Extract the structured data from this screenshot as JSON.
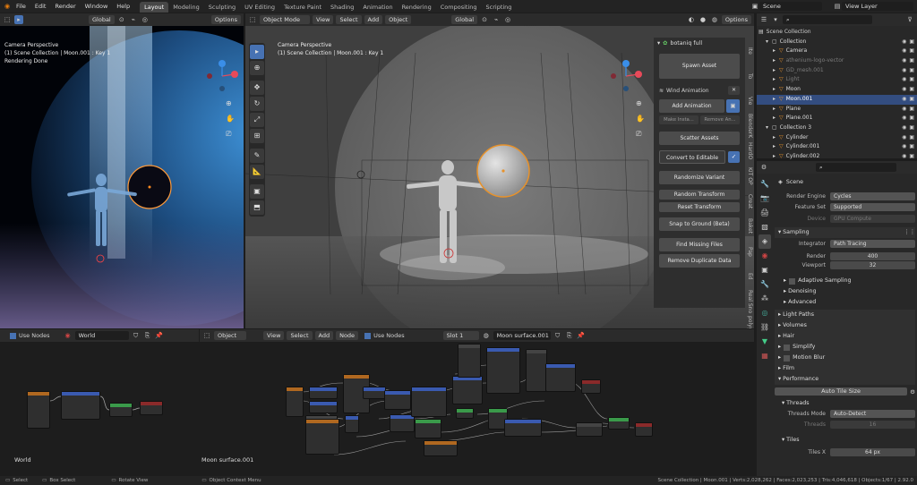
{
  "topbar": {
    "menus": [
      "File",
      "Edit",
      "Render",
      "Window",
      "Help"
    ],
    "workspaces": [
      "Layout",
      "Modeling",
      "Sculpting",
      "UV Editing",
      "Texture Paint",
      "Shading",
      "Animation",
      "Rendering",
      "Compositing",
      "Scripting"
    ],
    "scene": "Scene",
    "view_layer": "View Layer"
  },
  "left_viewport": {
    "orientation": "Global",
    "options": "Options",
    "line1": "Camera Perspective",
    "line2": "(1) Scene Collection | Moon.001 : Key 1",
    "line3": "Rendering Done"
  },
  "main_viewport": {
    "mode": "Object Mode",
    "menus": [
      "View",
      "Select",
      "Add",
      "Object"
    ],
    "orientation": "Global",
    "options": "Options",
    "line1": "Camera Perspective",
    "line2": "(1) Scene Collection | Moon.001 : Key 1"
  },
  "botaniq": {
    "title": "botaniq full",
    "spawn": "Spawn Asset",
    "wind": "Wind Animation",
    "add_anim": "Add Animation",
    "make_inst": "Make Insta...",
    "remove_anim": "Remove An...",
    "scatter": "Scatter Assets",
    "convert": "Convert to Editable",
    "randomize": "Randomize Variant",
    "random_transform": "Random Transform",
    "reset_transform": "Reset Transform",
    "snap": "Snap to Ground (Beta)",
    "find_missing": "Find Missing Files",
    "remove_dup": "Remove Duplicate Data"
  },
  "npanel_tabs": [
    "Ite",
    "To",
    "Vie",
    "BlenderK",
    "HardO",
    "KIT OP",
    "Creat",
    "Baket",
    "Pap",
    "Ed",
    "Real Sno",
    "polygon"
  ],
  "outliner": {
    "root": "Scene Collection",
    "items": [
      {
        "label": "Collection",
        "depth": 1,
        "color": "#dcdcdc"
      },
      {
        "label": "Camera",
        "depth": 2,
        "color": "#dcdcdc"
      },
      {
        "label": "athenium-logo-vector",
        "depth": 2,
        "color": "#7a7a7a"
      },
      {
        "label": "GD_mesh.001",
        "depth": 2,
        "color": "#7a7a7a"
      },
      {
        "label": "Light",
        "depth": 2,
        "color": "#7a7a7a"
      },
      {
        "label": "Moon",
        "depth": 2,
        "color": "#dcdcdc"
      },
      {
        "label": "Moon.001",
        "depth": 2,
        "color": "#ffffff",
        "selected": true
      },
      {
        "label": "Plane",
        "depth": 2,
        "color": "#dcdcdc"
      },
      {
        "label": "Plane.001",
        "depth": 2,
        "color": "#dcdcdc"
      },
      {
        "label": "Collection 3",
        "depth": 1,
        "color": "#dcdcdc"
      },
      {
        "label": "Cylinder",
        "depth": 2,
        "color": "#dcdcdc"
      },
      {
        "label": "Cylinder.001",
        "depth": 2,
        "color": "#dcdcdc"
      },
      {
        "label": "Cylinder.002",
        "depth": 2,
        "color": "#dcdcdc"
      }
    ]
  },
  "props": {
    "scene": "Scene",
    "render_engine_lbl": "Render Engine",
    "render_engine": "Cycles",
    "feature_set_lbl": "Feature Set",
    "feature_set": "Supported",
    "device_lbl": "Device",
    "device": "GPU Compute",
    "sampling": "Sampling",
    "integrator_lbl": "Integrator",
    "integrator": "Path Tracing",
    "render_lbl": "Render",
    "render_samples": "400",
    "viewport_lbl": "Viewport",
    "viewport_samples": "32",
    "adaptive": "Adaptive Sampling",
    "denoising": "Denoising",
    "advanced": "Advanced",
    "light_paths": "Light Paths",
    "volumes": "Volumes",
    "hair": "Hair",
    "simplify": "Simplify",
    "motion_blur": "Motion Blur",
    "film": "Film",
    "performance": "Performance",
    "auto_tile": "Auto Tile Size",
    "threads": "Threads",
    "threads_mode_lbl": "Threads Mode",
    "threads_mode": "Auto-Detect",
    "threads_lbl": "Threads",
    "threads_val": "16",
    "tiles": "Tiles",
    "tiles_x_lbl": "Tiles X",
    "tiles_x": "64 px"
  },
  "world_editor": {
    "use_nodes": "Use Nodes",
    "world": "World",
    "label": "World"
  },
  "shader_editor": {
    "object": "Object",
    "menus": [
      "View",
      "Select",
      "Add",
      "Node"
    ],
    "use_nodes": "Use Nodes",
    "slot": "Slot 1",
    "material": "Moon surface.001",
    "label": "Moon surface.001"
  },
  "status": {
    "select": "Select",
    "box_select": "Box Select",
    "rotate": "Rotate View",
    "context": "Object Context Menu",
    "stats": "Scene Collection | Moon.001 | Verts:2,028,262 | Faces:2,023,253 | Tris:4,046,618 | Objects:1/67 | 2.92.0"
  },
  "colors": {
    "accent": "#4772b3",
    "selected": "#334d80",
    "orange": "#e8922a"
  }
}
